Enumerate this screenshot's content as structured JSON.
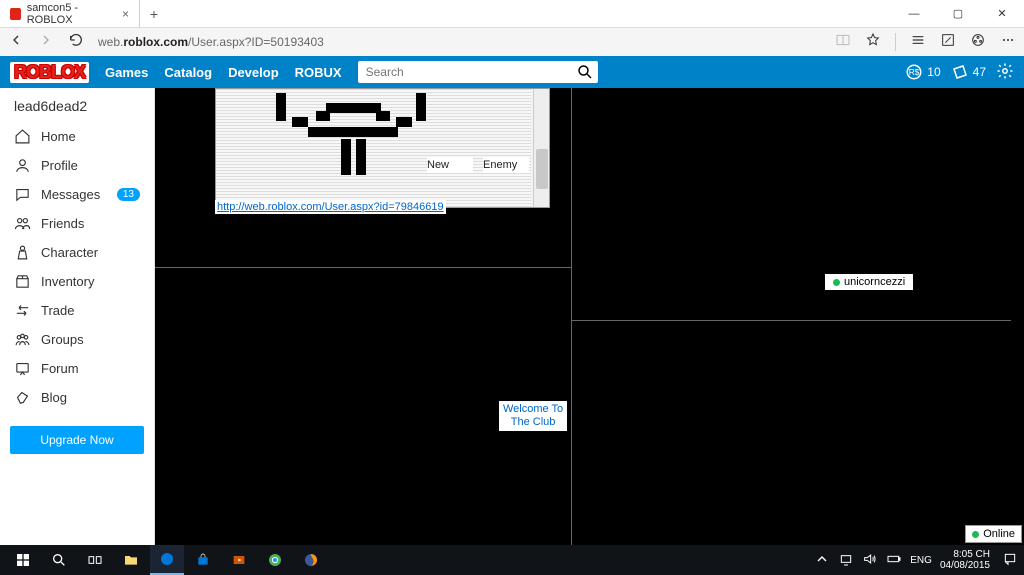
{
  "browser": {
    "tab_title": "samcon5 - ROBLOX",
    "url_prefix": "web.",
    "url_host": "roblox.com",
    "url_path": "/User.aspx?ID=50193403"
  },
  "nav": {
    "games": "Games",
    "catalog": "Catalog",
    "develop": "Develop",
    "robux": "ROBUX",
    "search_placeholder": "Search",
    "robux_count": "10",
    "tix_count": "47"
  },
  "sidebar": {
    "username": "lead6dead2",
    "home": "Home",
    "profile": "Profile",
    "messages": "Messages",
    "messages_badge": "13",
    "friends": "Friends",
    "character": "Character",
    "inventory": "Inventory",
    "trade": "Trade",
    "groups": "Groups",
    "forum": "Forum",
    "blog": "Blog",
    "upgrade": "Upgrade Now"
  },
  "content": {
    "new_label": "New",
    "enemy_label": "Enemy",
    "profile_link": "http://web.roblox.com/User.aspx?id=79846619",
    "welcome_line1": "Welcome To",
    "welcome_line2": "The Club",
    "friend_name": "unicorncezzi",
    "online_label": "Online"
  },
  "taskbar": {
    "lang": "ENG",
    "time": "8:05 CH",
    "date": "04/08/2015"
  }
}
